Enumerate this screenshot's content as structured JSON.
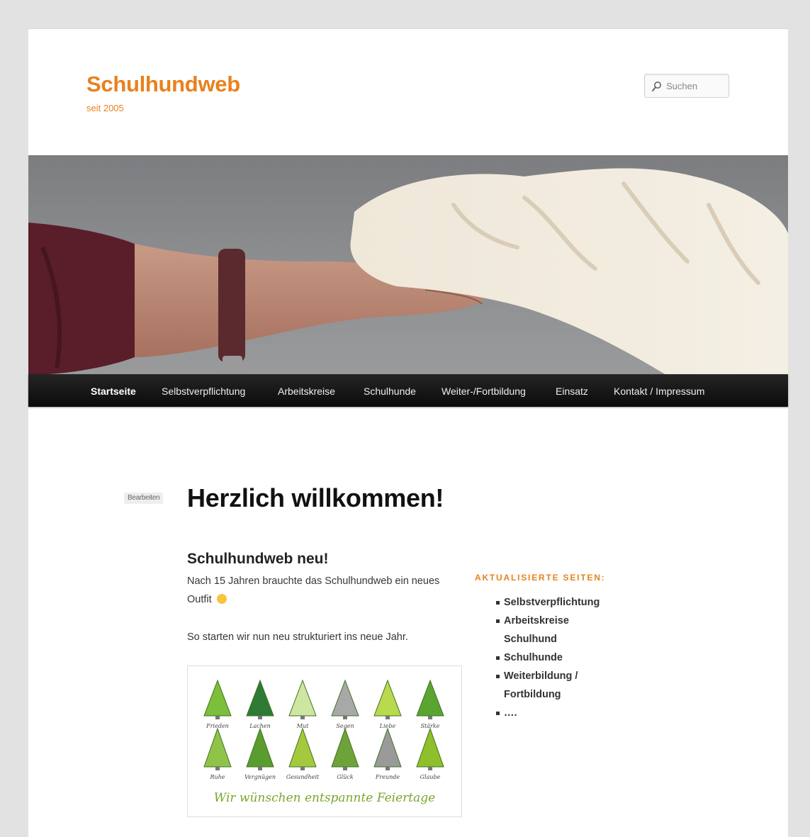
{
  "header": {
    "site_title": "Schulhundweb",
    "site_description": "seit 2005",
    "search_placeholder": "Suchen"
  },
  "nav": {
    "items": [
      {
        "label": "Startseite",
        "current": true
      },
      {
        "label": "Selbstverpflichtung"
      },
      {
        "label": "Arbeitskreise"
      },
      {
        "label": "Schulhunde"
      },
      {
        "label": "Weiter-/Fortbildung"
      },
      {
        "label": "Einsatz"
      },
      {
        "label": "Kontakt / Impressum"
      }
    ]
  },
  "content": {
    "edit_label": "Bearbeiten",
    "page_title": "Herzlich willkommen!",
    "post_title": "Schulhundweb neu!",
    "paragraph_1": "Nach 15 Jahren brauchte das Schulhundweb ein neues Outfit",
    "paragraph_2": "So starten wir nun neu strukturiert ins neue Jahr.",
    "image": {
      "trees_row_1": [
        "Frieden",
        "Lachen",
        "Mut",
        "Segen",
        "Liebe",
        "Stärke"
      ],
      "trees_row_2": [
        "Ruhe",
        "Vergnügen",
        "Gesundheit",
        "Glück",
        "Freunde",
        "Glaube"
      ],
      "greeting": "Wir wünschen entspannte Feiertage"
    }
  },
  "sidebar": {
    "widget_title": "Aktualisierte Seiten:",
    "items": [
      "Selbstverpflichtung",
      "Arbeitskreise Schulhund",
      "Schulhunde",
      "Weiterbildung / Fortbildung",
      "…."
    ]
  },
  "colors": {
    "accent": "#e8811d",
    "nav_background": "#1a1a1a",
    "page_background": "#e2e2e2"
  }
}
